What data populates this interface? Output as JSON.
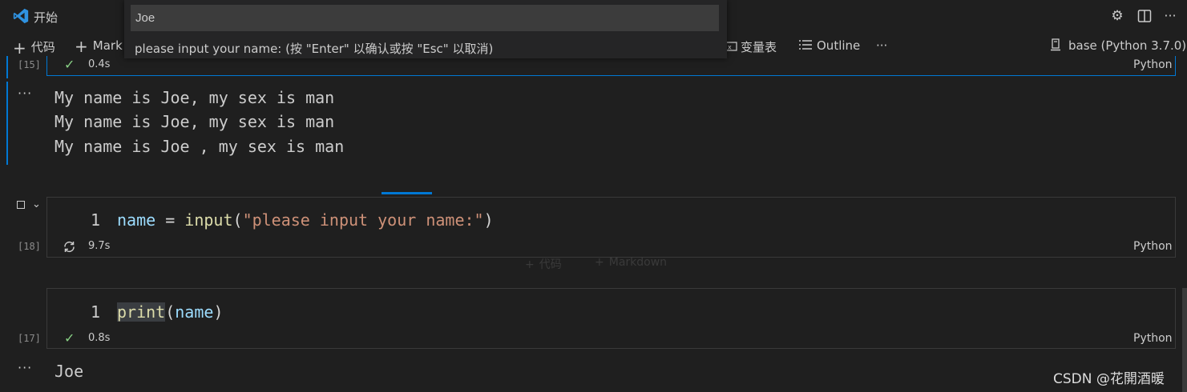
{
  "titlebar": {
    "tab_title": "开始",
    "icons": [
      "vscode-logo",
      "gear-icon",
      "split-editor-icon",
      "more-icon"
    ]
  },
  "toolbar": {
    "code_label": "代码",
    "markdown_label": "Mark",
    "variables_label": "变量表",
    "outline_label": "Outline",
    "more_label": "···",
    "kernel_label": "base (Python 3.7.0)"
  },
  "quick_input": {
    "value": "Joe",
    "message": "please input your name: (按 \"Enter\" 以确认或按 \"Esc\" 以取消)"
  },
  "cells": {
    "cell15": {
      "exec_count": "[15]",
      "duration": "0.4s",
      "language": "Python",
      "output": [
        "My name is Joe, my sex is man",
        "My name is Joe, my sex is man",
        "My name is Joe , my sex is man"
      ]
    },
    "cell18": {
      "exec_count": "[18]",
      "duration": "9.7s",
      "language": "Python",
      "line_number": "1",
      "code": {
        "var": "name",
        "op": " = ",
        "fn": "input",
        "paren_open": "(",
        "str": "\"please input your name:\"",
        "paren_close": ")"
      }
    },
    "insert_bar": {
      "code_label": "代码",
      "markdown_label": "Markdown"
    },
    "cell17": {
      "exec_count": "[17]",
      "duration": "0.8s",
      "language": "Python",
      "line_number": "1",
      "code": {
        "fn": "print",
        "paren_open": "(",
        "var": "name",
        "paren_close": ")"
      },
      "output": [
        "Joe"
      ]
    }
  },
  "watermark": "CSDN @花開酒暖",
  "colors": {
    "accent": "#0078d4",
    "success": "#89d185",
    "string": "#ce9178",
    "function": "#dcdcaa",
    "variable": "#9cdcfe"
  }
}
